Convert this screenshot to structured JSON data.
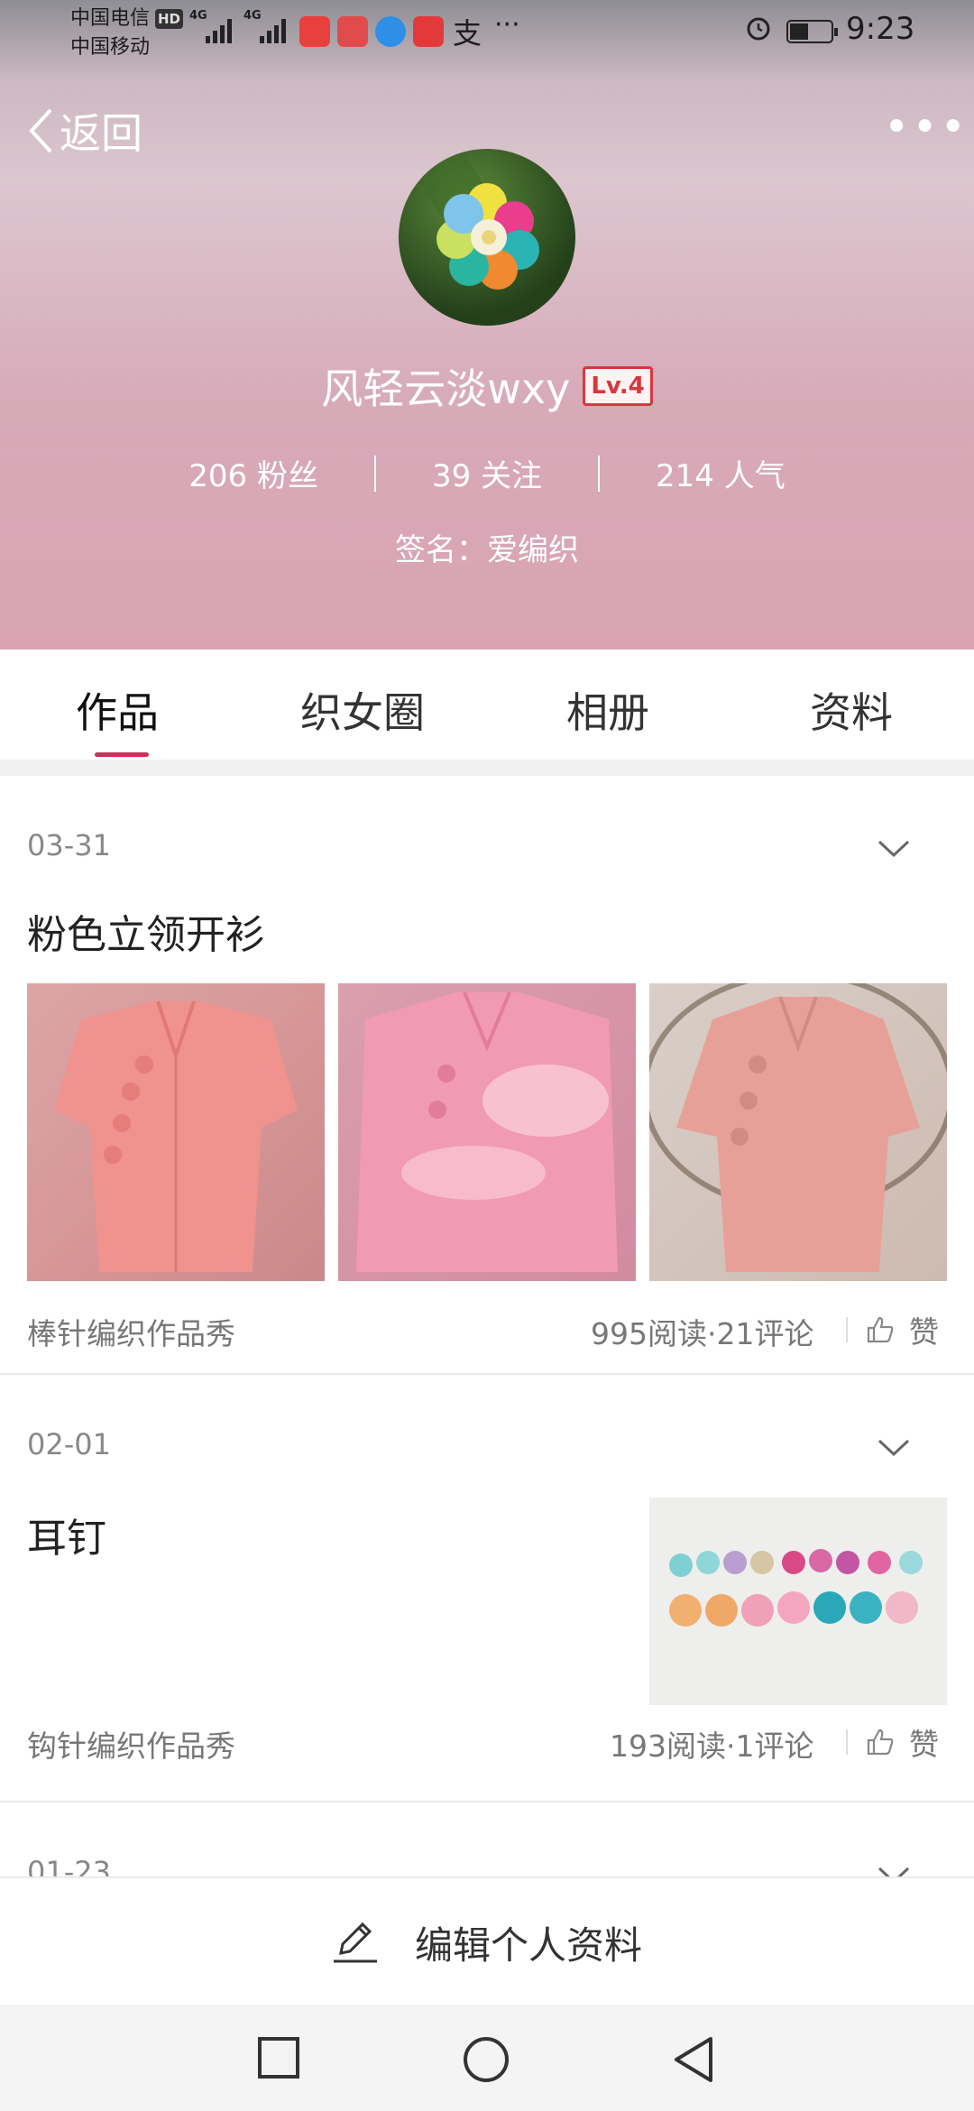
{
  "status_bar": {
    "carrier1": "中国电信",
    "carrier2": "中国移动",
    "hd": "HD",
    "net1": "4G",
    "net2": "4G",
    "app_text": "支",
    "more": "···",
    "time": "9:23"
  },
  "header": {
    "back_label": "返回",
    "more": "•••",
    "username": "风轻云淡wxy",
    "level": "Lv.4",
    "stats": [
      {
        "value": "206",
        "label": "粉丝"
      },
      {
        "value": "39",
        "label": "关注"
      },
      {
        "value": "214",
        "label": "人气"
      }
    ],
    "signature": "签名：爱编织"
  },
  "tabs": [
    {
      "label": "作品",
      "active": true
    },
    {
      "label": "织女圈",
      "active": false
    },
    {
      "label": "相册",
      "active": false
    },
    {
      "label": "资料",
      "active": false
    }
  ],
  "posts": [
    {
      "date": "03-31",
      "title": "粉色立领开衫",
      "category": "棒针编织作品秀",
      "stats": "995阅读·21评论",
      "like_label": "赞"
    },
    {
      "date": "02-01",
      "title": "耳钉",
      "category": "钩针编织作品秀",
      "stats": "193阅读·1评论",
      "like_label": "赞"
    },
    {
      "date": "01-23"
    }
  ],
  "edit_bar": {
    "label": "编辑个人资料"
  },
  "colors": {
    "accent": "#cf2f5b",
    "level_red": "#d9363e",
    "hero_pink": "#d9a3b3"
  }
}
